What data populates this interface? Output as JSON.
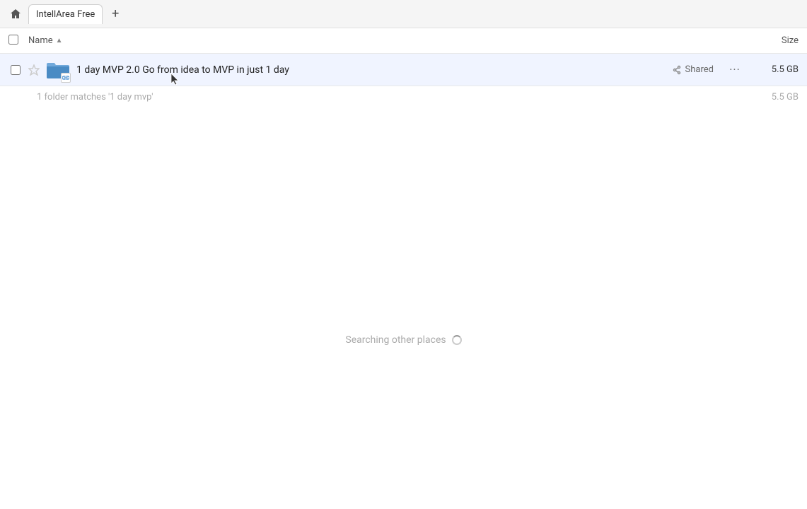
{
  "topbar": {
    "home_icon": "🏠",
    "tab_label": "IntellArea Free",
    "new_tab_icon": "+"
  },
  "columns": {
    "name_label": "Name",
    "sort_icon": "▲",
    "size_label": "Size"
  },
  "file_row": {
    "folder_name": "1 day MVP 2.0 Go from idea to MVP in just 1 day",
    "shared_label": "Shared",
    "more_label": "···",
    "file_size": "5.5 GB"
  },
  "matches": {
    "text": "1 folder matches '1 day mvp'",
    "size": "5.5 GB"
  },
  "searching": {
    "text": "Searching other places"
  }
}
